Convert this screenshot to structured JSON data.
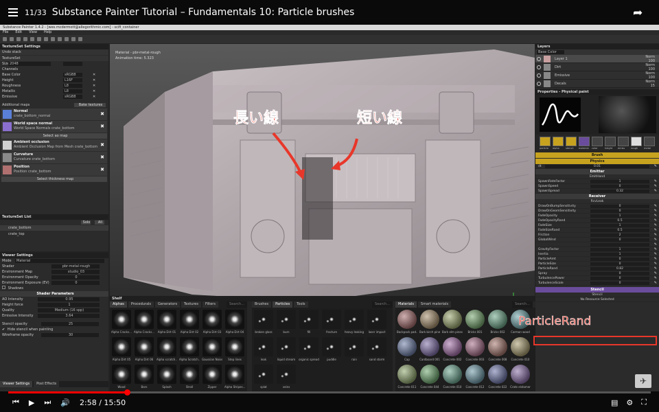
{
  "video": {
    "counter": "11/33",
    "title": "Substance Painter Tutorial – Fundamentals 10: Particle brushes",
    "time_current": "2:58",
    "time_separator": "/",
    "time_total": "15:50",
    "progress": 0.187
  },
  "app": {
    "window_title": "Substance Painter 1.4.2 - [wes.mcdermott@allegorithmic.com] - scifi_container",
    "menu": [
      "File",
      "Edit",
      "View",
      "Help"
    ]
  },
  "textureset_settings": {
    "title": "TextureSet Settings",
    "undo_stack": "Undo stack",
    "textureset": "TextureSet",
    "size_label": "Size",
    "size_value": "2048",
    "channels_label": "Channels",
    "channels": [
      {
        "name": "Base Color",
        "format": "sRGB8"
      },
      {
        "name": "Height",
        "format": "L16F"
      },
      {
        "name": "Roughness",
        "format": "L8"
      },
      {
        "name": "Metallic",
        "format": "L8"
      },
      {
        "name": "Emissive",
        "format": "sRGB8"
      }
    ],
    "additional_maps": "Additional maps",
    "bake_textures": "Bake textures",
    "maps": [
      {
        "title": "Normal",
        "sub": "crate_bottom_normal",
        "color": "#5a7fd6"
      },
      {
        "title": "World space normal",
        "sub": "World Space Normals crate_bottom",
        "color": "#8a6fd0"
      },
      {
        "title": "Ambient occlusion",
        "sub": "Ambient Occlusion Map from Mesh crate_bottom",
        "color": "#cfcfcf"
      },
      {
        "title": "Curvature",
        "sub": "Curvature crate_bottom",
        "color": "#8a8a8a"
      },
      {
        "title": "Position",
        "sub": "Position crate_bottom",
        "color": "#b07070"
      }
    ],
    "select_ao_map": "Select ao map",
    "select_thickness_map": "Select thickness map"
  },
  "textureset_list": {
    "title": "TextureSet List",
    "solo": "Solo",
    "all": "All",
    "items": [
      "crate_bottom",
      "crate_top"
    ]
  },
  "viewer_settings": {
    "title": "Viewer Settings",
    "mode_label": "Mode",
    "mode_value": "Material",
    "rows": [
      {
        "label": "Shader",
        "value": "pbr-metal-rough"
      },
      {
        "label": "Environment Map",
        "value": "studio_03"
      },
      {
        "label": "Environment Opacity",
        "value": "0"
      },
      {
        "label": "Environment Exposure (EV)",
        "value": "0"
      }
    ],
    "shadows": "Shadows",
    "shader_params": "Shader Parameters",
    "params": [
      {
        "label": "AO Intensity",
        "value": "0.95"
      },
      {
        "label": "Height force",
        "value": "1"
      },
      {
        "label": "Quality",
        "value": "Medium (16 spp)"
      },
      {
        "label": "Emissive Intensity",
        "value": "3.64"
      }
    ],
    "stencil_opacity_label": "Stencil opacity",
    "stencil_opacity_value": "25",
    "hide_stencil": "Hide stencil when painting",
    "wireframe_label": "Wireframe opacity",
    "wireframe_value": "30",
    "bottom_tabs": [
      "Viewer Settings",
      "Post Effects"
    ]
  },
  "viewport": {
    "material_line": "Material - pbr-metal-rough",
    "animation_line": "Animation time: 5.323",
    "anno_long": "長い線",
    "anno_short": "短い線",
    "anno_particle": "ParticleRand"
  },
  "shelf": {
    "title": "Shelf",
    "tabs_left": [
      "Alphas",
      "Procedurals",
      "Generators",
      "Textures",
      "Filters"
    ],
    "search": "Search...",
    "alphas": [
      "Alpha Cracks...",
      "Alpha Cracks...",
      "Alpha Dirt 01",
      "Alpha Dirt 02",
      "Alpha Dirt 03",
      "Alpha Dirt 04",
      "Alpha Dirt 05",
      "Alpha Dirt 06",
      "Alpha scratch...",
      "Alpha Scratch...",
      "Gaussian Noise",
      "Step lines",
      "Wood",
      "Bars",
      "Splash",
      "Stroll",
      "Zipper",
      "Alpha Stripes..."
    ],
    "tabs_mid": [
      "Brushes",
      "Particles",
      "Tools"
    ],
    "particles": [
      "broken glass",
      "burn",
      "fill",
      "fracture",
      "heavy leaking",
      "laser impact",
      "leak",
      "liquid stream",
      "organic spread",
      "puddle",
      "rain",
      "sand storm",
      "splat",
      "veins"
    ],
    "tabs_right": [
      "Materials",
      "Smart materials"
    ],
    "materials": [
      "Backpack pad...",
      "Bark birch pine",
      "Bark elm pines",
      "Bricks 001",
      "Bricks 002",
      "Carman wood",
      "Cap",
      "Cardboard 001",
      "Concrete 002",
      "Concrete 003",
      "Concrete 008",
      "Concrete 010",
      "Concrete 011",
      "Concrete 044",
      "Concrete 010",
      "Concrete 012",
      "Concrete 022",
      "Crate elstomer"
    ]
  },
  "layers": {
    "title": "Layers",
    "blend": "Base Color",
    "items": [
      {
        "name": "Layer 1",
        "mode": "Norm",
        "opacity": "100"
      },
      {
        "name": "Dirt",
        "mode": "Norm",
        "opacity": "100"
      },
      {
        "name": "Emissive",
        "mode": "Norm",
        "opacity": "100"
      },
      {
        "name": "Decals",
        "mode": "Norm",
        "opacity": "15"
      }
    ]
  },
  "properties": {
    "title": "Properties - Physical paint",
    "channel_labels": [
      "particle",
      "alpha",
      "stencil",
      "material",
      "color",
      "height",
      "emiss",
      "rough",
      "metal"
    ],
    "brush": "Brush",
    "physics": "Physics",
    "dt_label": "dt",
    "dt_value": "0.01",
    "emitter": "Emitter",
    "emitter_sub": "EmitHand",
    "emitter_rows": [
      {
        "label": "SpawnRateFactor",
        "value": "1"
      },
      {
        "label": "SpawnSpeed",
        "value": "0"
      },
      {
        "label": "SpawnSpread",
        "value": "0.32"
      }
    ],
    "receiver": "Receiver",
    "receiver_sub": "RcvLeak",
    "receiver_rows": [
      {
        "label": "DrawOnBumpSensitivity",
        "value": "0"
      },
      {
        "label": "DrawOnGeomSensitivity",
        "value": "0"
      },
      {
        "label": "FadeOpacity",
        "value": "1"
      },
      {
        "label": "FadeOpacityRand",
        "value": "0.5"
      },
      {
        "label": "FadeSize",
        "value": "1"
      },
      {
        "label": "FadeSizeRand",
        "value": "0.5"
      },
      {
        "label": "Friction",
        "value": "2"
      },
      {
        "label": "GlobalWind",
        "value": "0"
      },
      {
        "label": "",
        "value": ""
      },
      {
        "label": "GravityFactor",
        "value": "1"
      },
      {
        "label": "Inertia",
        "value": "1"
      },
      {
        "label": "ParticleAmt",
        "value": "0"
      },
      {
        "label": "ParticleSize",
        "value": "0"
      },
      {
        "label": "ParticleRand",
        "value": "0.82"
      },
      {
        "label": "Spray",
        "value": "0"
      },
      {
        "label": "TurbulencePower",
        "value": "0"
      },
      {
        "label": "TurbulenceScale",
        "value": "0"
      }
    ],
    "stencil": "Stencil",
    "stencil_sub": "Stencil",
    "no_resource": "No Resource Selected"
  },
  "colors": {
    "accent_yellow": "#c7a21f",
    "red": "#e8372a",
    "section_purple": "#6a4c9c"
  }
}
